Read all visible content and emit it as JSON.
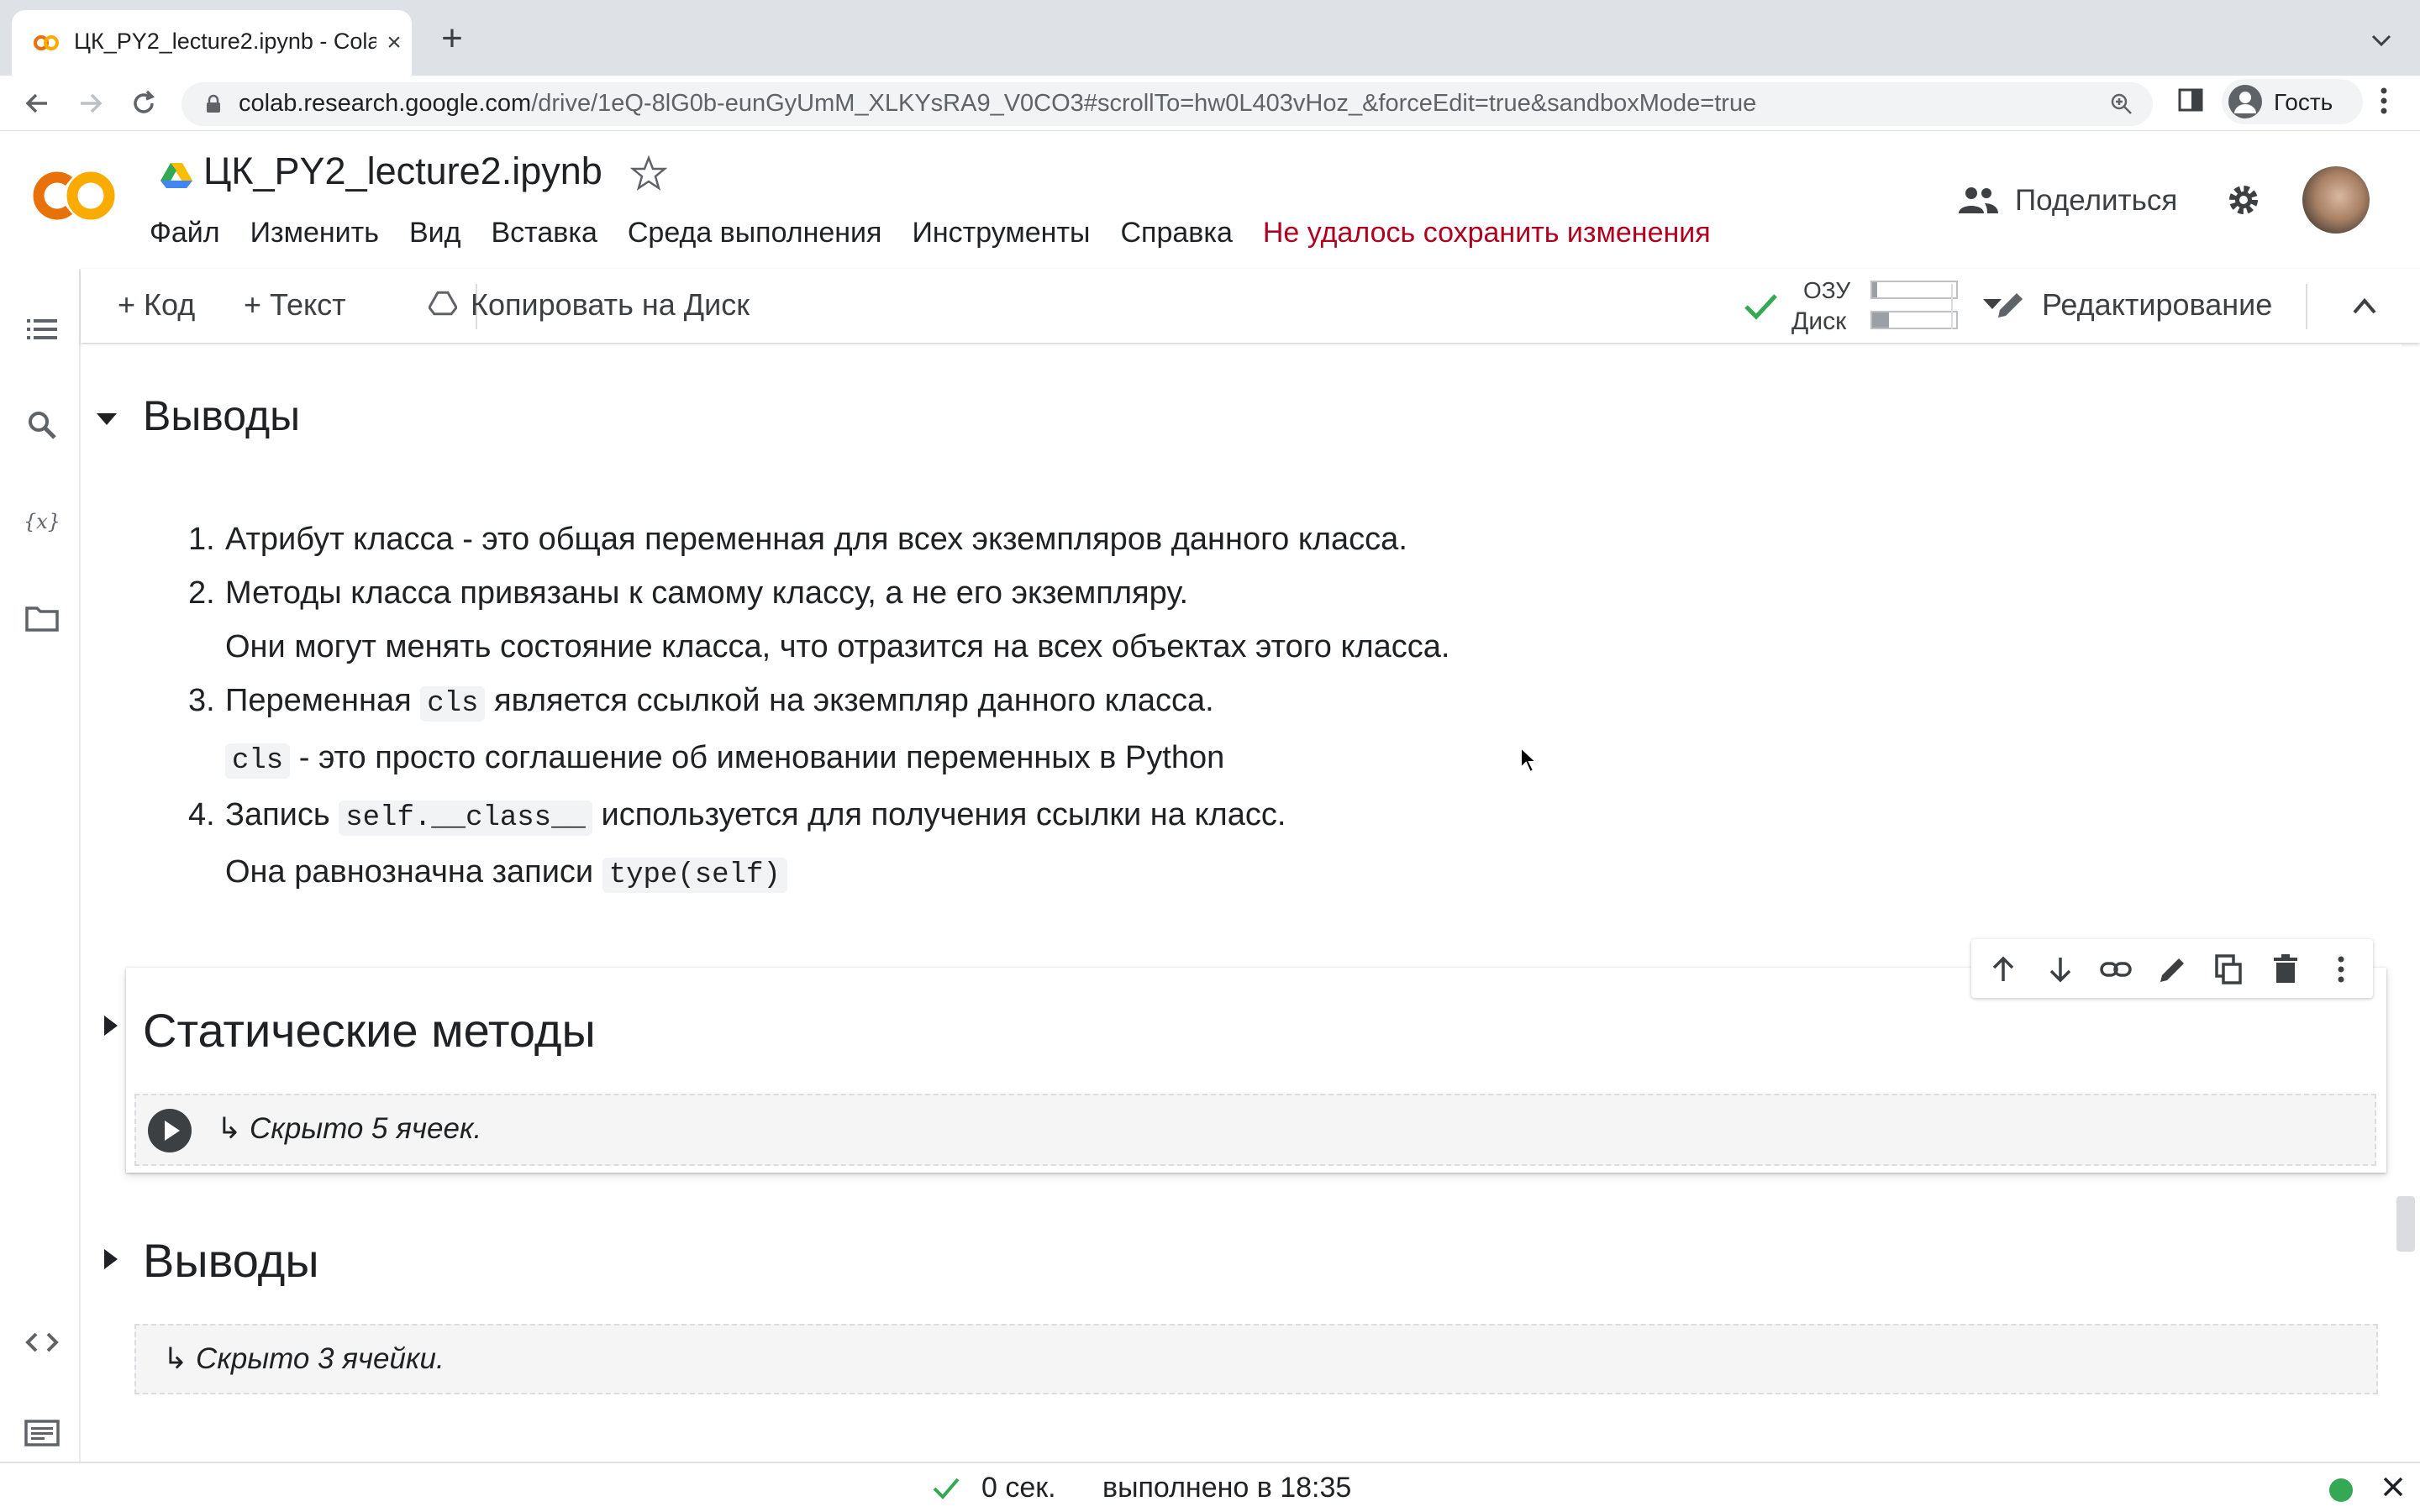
{
  "browser": {
    "tab_title": "ЦК_PY2_lecture2.ipynb - Colab",
    "new_tab_label": "+",
    "tab_close_label": "×",
    "url_host": "colab.research.google.com",
    "url_path": "/drive/1eQ-8lG0b-eunGyUmM_XLKYsRA9_V0CO3#scrollTo=hw0L403vHoz_&forceEdit=true&sandboxMode=true",
    "profile_name": "Гость"
  },
  "colab": {
    "notebook_title": "ЦК_PY2_lecture2.ipynb",
    "menu": [
      "Файл",
      "Изменить",
      "Вид",
      "Вставка",
      "Среда выполнения",
      "Инструменты",
      "Справка"
    ],
    "save_warning": "Не удалось сохранить изменения",
    "share_label": "Поделиться"
  },
  "toolbar": {
    "add_code": "+ Код",
    "add_text": "+ Текст",
    "copy_to_drive": "Копировать на Диск",
    "ram_label": "ОЗУ",
    "disk_label": "Диск",
    "ram_usage": 0.06,
    "disk_usage": 0.2,
    "edit_mode": "Редактирование"
  },
  "content": {
    "section1_title": "Выводы",
    "points": [
      {
        "num": "1.",
        "line1": "Атрибут класса - это общая переменная для всех экземпляров данного класса."
      },
      {
        "num": "2.",
        "line1": "Методы класса привязаны к самому классу, а не его экземпляру.",
        "line2": "Они могут менять состояние класса, что отразится на всех объектах этого класса."
      },
      {
        "num": "3.",
        "line1_pre": "Переменная ",
        "line1_code": "cls",
        "line1_post": " является ссылкой на экземпляр данного класса.",
        "line2_code": "cls",
        "line2_post": " - это просто соглашение об именовании переменных в Python"
      },
      {
        "num": "4.",
        "line1_pre": "Запись ",
        "line1_code": "self.__class__",
        "line1_post": " используется для получения ссылки на класс.",
        "line2_pre": "Она равнозначна записи ",
        "line2_code": "type(self)"
      }
    ],
    "section2_title": "Статические методы",
    "section2_hidden": "↳ Скрыто 5 ячеек.",
    "section3_title": "Выводы",
    "section3_hidden": "↳ Скрыто 3 ячейки."
  },
  "status": {
    "elapsed": "0 сек.",
    "completed": "выполнено в 18:35"
  },
  "colors": {
    "colab_orange": "#f9ab00",
    "colab_orange_dark": "#e8710a",
    "warning_red": "#b00020",
    "check_green": "#34a853"
  }
}
